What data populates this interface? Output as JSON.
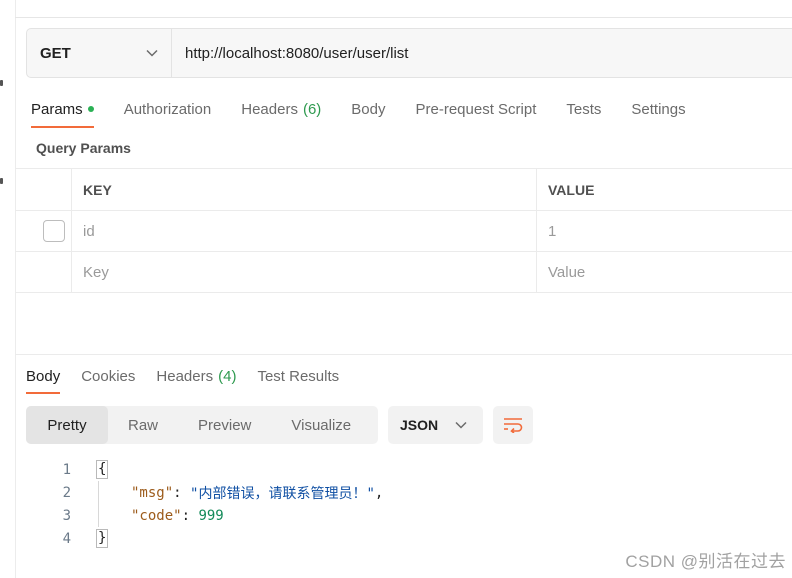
{
  "request": {
    "method": "GET",
    "url": "http://localhost:8080/user/user/list"
  },
  "request_tabs": [
    {
      "label": "Params",
      "active": true,
      "indicator": "green-dot"
    },
    {
      "label": "Authorization"
    },
    {
      "label": "Headers",
      "count": "(6)"
    },
    {
      "label": "Body"
    },
    {
      "label": "Pre-request Script"
    },
    {
      "label": "Tests"
    },
    {
      "label": "Settings"
    }
  ],
  "query_params": {
    "title": "Query Params",
    "headers": {
      "key": "KEY",
      "value": "VALUE"
    },
    "rows": [
      {
        "key": "id",
        "value": "1",
        "checked": false
      }
    ],
    "new_row": {
      "key_placeholder": "Key",
      "value_placeholder": "Value"
    }
  },
  "response_tabs": [
    {
      "label": "Body",
      "active": true
    },
    {
      "label": "Cookies"
    },
    {
      "label": "Headers",
      "count": "(4)"
    },
    {
      "label": "Test Results"
    }
  ],
  "response_view": {
    "modes": [
      "Pretty",
      "Raw",
      "Preview",
      "Visualize"
    ],
    "active_mode": "Pretty",
    "format": "JSON",
    "wrap_icon": "wrap-lines-icon"
  },
  "response_body": {
    "line_numbers": [
      "1",
      "2",
      "3",
      "4"
    ],
    "open_brace": "{",
    "close_brace": "}",
    "msg_key": "\"msg\"",
    "msg_value": "\"内部错误，请联系管理员！\"",
    "code_key": "\"code\"",
    "code_value": "999"
  },
  "watermark": "CSDN @别活在过去",
  "colors": {
    "accent": "#f26b3a",
    "indicator": "#2bb155",
    "count": "#2e9a4f"
  }
}
